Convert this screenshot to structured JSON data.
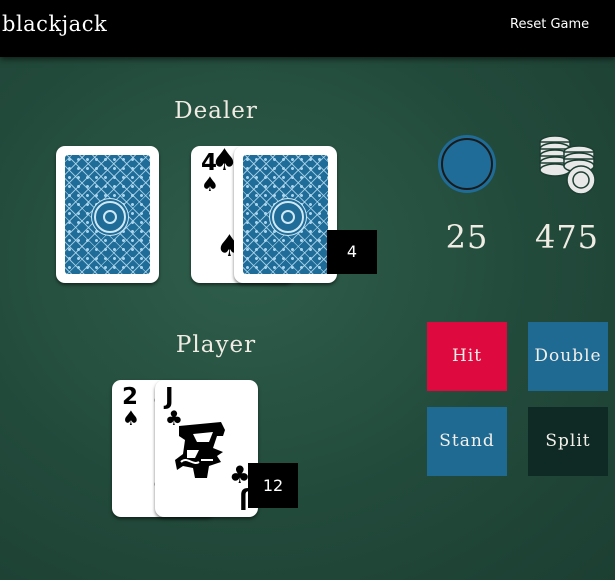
{
  "header": {
    "brand": "blackjack",
    "reset_label": "Reset Game"
  },
  "dealer": {
    "title": "Dealer",
    "total": "4",
    "cards": [
      {
        "face": "down"
      },
      {
        "face": "up",
        "rank": "4",
        "suit": "spades"
      },
      {
        "face": "down"
      }
    ]
  },
  "player": {
    "title": "Player",
    "total": "12",
    "cards": [
      {
        "face": "up",
        "rank": "2",
        "suit": "spades"
      },
      {
        "face": "up",
        "rank": "J",
        "suit": "clubs"
      }
    ]
  },
  "stats": {
    "bet": {
      "icon": "chip-icon",
      "value": "25"
    },
    "bank": {
      "icon": "chip-stack-icon",
      "value": "475"
    }
  },
  "actions": {
    "hit": "Hit",
    "double": "Double",
    "stand": "Stand",
    "split": "Split"
  },
  "colors": {
    "table": "#2a5646",
    "hit": "#de0a3f",
    "double": "#1f6a93",
    "stand": "#1f6a93",
    "split": "#0f2a24",
    "card_back": "#1e6c97",
    "chip": "#1e6c97"
  }
}
